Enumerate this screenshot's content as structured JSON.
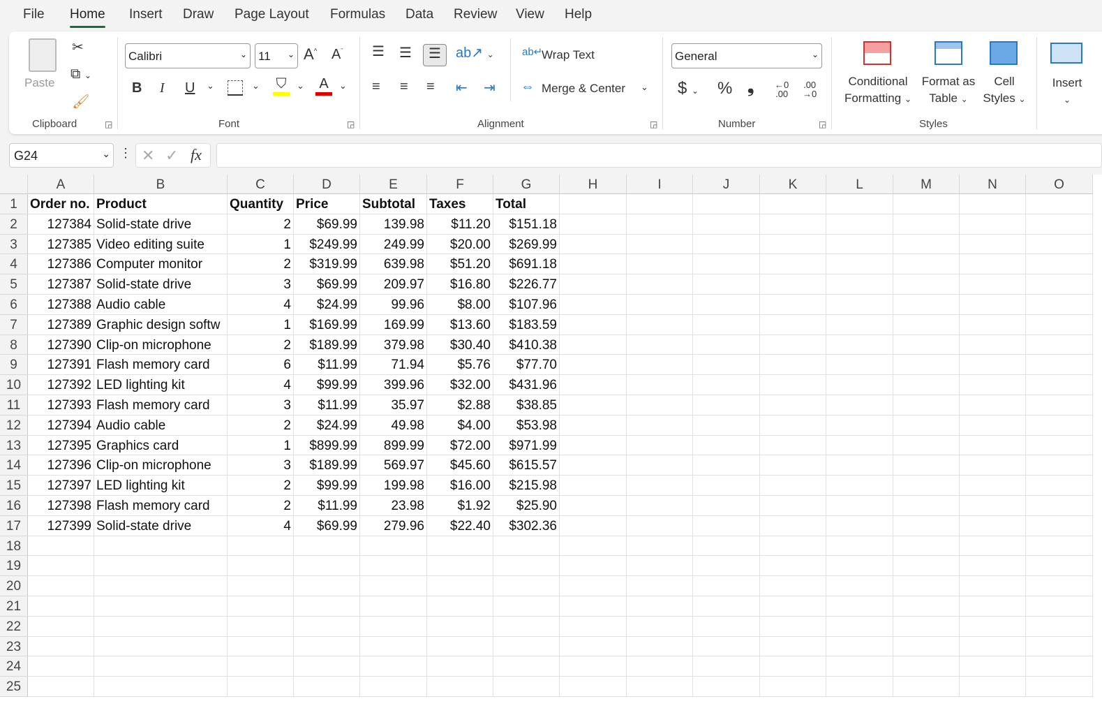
{
  "menu_tabs": [
    "File",
    "Home",
    "Insert",
    "Draw",
    "Page Layout",
    "Formulas",
    "Data",
    "Review",
    "View",
    "Help"
  ],
  "active_tab": "Home",
  "ribbon": {
    "clipboard": {
      "label": "Clipboard",
      "paste": "Paste"
    },
    "font": {
      "label": "Font",
      "font_name": "Calibri",
      "font_size": "11",
      "bold": "B",
      "italic": "I",
      "underline": "U",
      "font_color_letter": "A",
      "highlight_color": "#ffff00",
      "font_color": "#e00000"
    },
    "alignment": {
      "label": "Alignment",
      "wrap_text": "Wrap Text",
      "merge_center": "Merge & Center"
    },
    "number": {
      "label": "Number",
      "format": "General",
      "currency": "$",
      "percent": "%",
      "comma": "❟"
    },
    "styles": {
      "label": "Styles",
      "conditional_formatting": [
        "Conditional",
        "Formatting"
      ],
      "format_as_table": [
        "Format as",
        "Table"
      ],
      "cell_styles": [
        "Cell",
        "Styles"
      ]
    },
    "cells": {
      "insert": "Insert"
    }
  },
  "formula_bar": {
    "name_box": "G24",
    "fx": "fx",
    "value": ""
  },
  "sheet": {
    "columns": [
      "A",
      "B",
      "C",
      "D",
      "E",
      "F",
      "G",
      "H",
      "I",
      "J",
      "K",
      "L",
      "M",
      "N",
      "O"
    ],
    "row_numbers": [
      "1",
      "2",
      "3",
      "4",
      "5",
      "6",
      "7",
      "8",
      "9",
      "10",
      "11",
      "12",
      "13",
      "14",
      "15",
      "16",
      "17",
      "18",
      "19",
      "20",
      "21",
      "22",
      "23",
      "24",
      "25"
    ],
    "headers": [
      "Order no.",
      "Product",
      "Quantity",
      "Price",
      "Subtotal",
      "Taxes",
      "Total"
    ],
    "rows": [
      [
        "127384",
        "Solid-state drive",
        "2",
        "$69.99",
        "139.98",
        "$11.20",
        "$151.18"
      ],
      [
        "127385",
        "Video editing suite",
        "1",
        "$249.99",
        "249.99",
        "$20.00",
        "$269.99"
      ],
      [
        "127386",
        "Computer monitor",
        "2",
        "$319.99",
        "639.98",
        "$51.20",
        "$691.18"
      ],
      [
        "127387",
        "Solid-state drive",
        "3",
        "$69.99",
        "209.97",
        "$16.80",
        "$226.77"
      ],
      [
        "127388",
        "Audio cable",
        "4",
        "$24.99",
        "99.96",
        "$8.00",
        "$107.96"
      ],
      [
        "127389",
        "Graphic design softw",
        "1",
        "$169.99",
        "169.99",
        "$13.60",
        "$183.59"
      ],
      [
        "127390",
        "Clip-on microphone",
        "2",
        "$189.99",
        "379.98",
        "$30.40",
        "$410.38"
      ],
      [
        "127391",
        "Flash memory card",
        "6",
        "$11.99",
        "71.94",
        "$5.76",
        "$77.70"
      ],
      [
        "127392",
        "LED lighting kit",
        "4",
        "$99.99",
        "399.96",
        "$32.00",
        "$431.96"
      ],
      [
        "127393",
        "Flash memory card",
        "3",
        "$11.99",
        "35.97",
        "$2.88",
        "$38.85"
      ],
      [
        "127394",
        "Audio cable",
        "2",
        "$24.99",
        "49.98",
        "$4.00",
        "$53.98"
      ],
      [
        "127395",
        "Graphics card",
        "1",
        "$899.99",
        "899.99",
        "$72.00",
        "$971.99"
      ],
      [
        "127396",
        "Clip-on microphone",
        "3",
        "$189.99",
        "569.97",
        "$45.60",
        "$615.57"
      ],
      [
        "127397",
        "LED lighting kit",
        "2",
        "$99.99",
        "199.98",
        "$16.00",
        "$215.98"
      ],
      [
        "127398",
        "Flash memory card",
        "2",
        "$11.99",
        "23.98",
        "$1.92",
        "$25.90"
      ],
      [
        "127399",
        "Solid-state drive",
        "4",
        "$69.99",
        "279.96",
        "$22.40",
        "$302.36"
      ]
    ]
  }
}
